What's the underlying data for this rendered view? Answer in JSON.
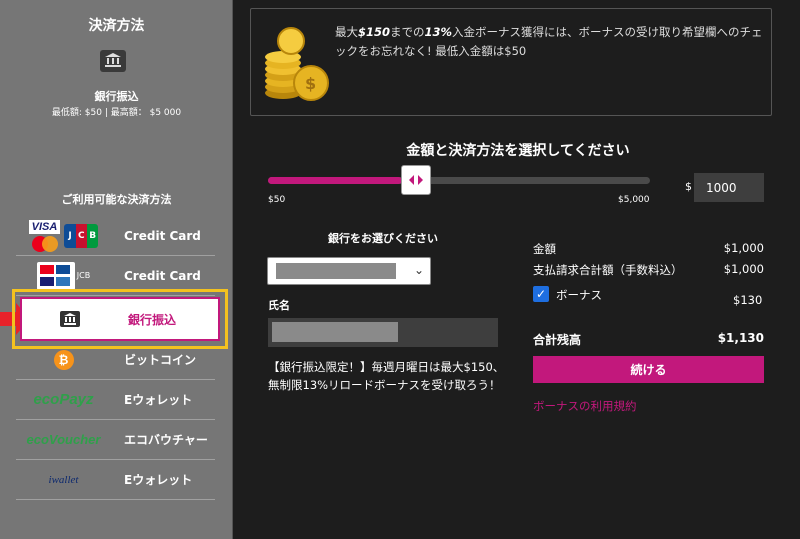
{
  "sidebar": {
    "title": "決済方法",
    "selected_name": "銀行振込",
    "selected_limits": "最低額: $50 | 最高額： $5 000",
    "available_title": "ご利用可能な決済方法",
    "methods": [
      {
        "label": "Credit Card",
        "logo": "VISA"
      },
      {
        "label": "Credit Card",
        "logo": "JCB"
      },
      {
        "label": "銀行振込",
        "logo": "bank-icon"
      },
      {
        "label": "ビットコイン",
        "logo": "₿"
      },
      {
        "label": "Eウォレット",
        "logo": "ecoPayz"
      },
      {
        "label": "エコバウチャー",
        "logo": "ecoVoucher"
      },
      {
        "label": "Eウォレット",
        "logo": "iwallet"
      }
    ],
    "jcb_letters": [
      "J",
      "C",
      "B"
    ]
  },
  "promo": {
    "line_pre1": "最大",
    "bold1": "$150",
    "line_mid": "までの",
    "bold2": "13%",
    "line_post": "入金ボーナス獲得には、ボーナスの受け取り希望欄へのチェックをお忘れなく! 最低入金額は$50"
  },
  "form": {
    "select_title": "金額と決済方法を選択してください",
    "slider_min": "$50",
    "slider_max": "$5,000",
    "slider_fraction": 0.35,
    "currency_symbol": "$",
    "amount_value": "1000",
    "bank_title": "銀行をお選びください",
    "name_label": "氏名",
    "note": "【銀行振込限定！】毎週月曜日は最大$150、無制限13%リロードボーナスを受け取ろう！"
  },
  "summary": {
    "amount_label": "金額",
    "amount_value": "$1,000",
    "charge_label": "支払請求合計額（手数料込）",
    "charge_value": "$1,000",
    "bonus_label": "ボーナス",
    "bonus_value": "$130",
    "total_label": "合計残高",
    "total_value": "$1,130",
    "continue_label": "続ける",
    "terms_label": "ボーナスの利用規約"
  },
  "colors": {
    "accent": "#c2187c",
    "highlight": "#f3c21f",
    "sidebar_bg": "#767676",
    "main_bg": "#1d1d1d"
  }
}
